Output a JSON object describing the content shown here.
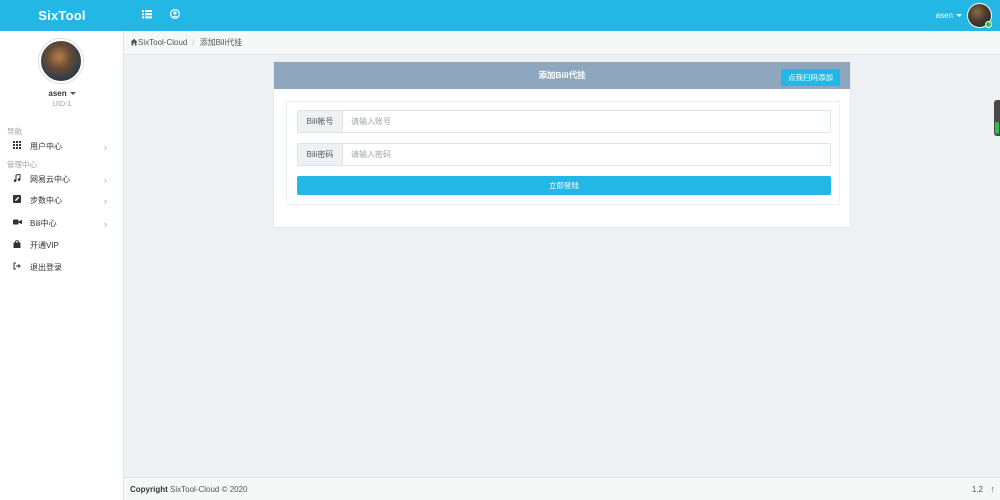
{
  "topbar": {
    "brand": "SixTool",
    "user_name": "asen"
  },
  "sidebar": {
    "user_name": "asen",
    "uid": "UID:1",
    "heading_nav": "导航",
    "heading_admin": "管理中心",
    "items": [
      {
        "label": "用户中心",
        "icon": "grid-icon",
        "chevron": "›"
      },
      {
        "label": "网易云中心",
        "icon": "music-note-icon",
        "chevron": "›"
      },
      {
        "label": "步数中心",
        "icon": "edit-square-icon",
        "chevron": "›"
      },
      {
        "label": "Bili中心",
        "icon": "video-camera-icon",
        "chevron": "›"
      },
      {
        "label": "开通VIP",
        "icon": "bag-icon"
      },
      {
        "label": "退出登录",
        "icon": "logout-icon"
      }
    ]
  },
  "breadcrumb": {
    "home": "SixTool-Cloud",
    "current": "添加Bili代挂"
  },
  "panel": {
    "title": "添加Bili代挂",
    "scan_button": "点我扫码添加",
    "account_label": "Bili帐号",
    "account_placeholder": "请输入账号",
    "password_label": "Bili密码",
    "password_placeholder": "请输入密码",
    "login_button": "立即登陆"
  },
  "footer": {
    "copyright_label": "Copyright",
    "copyright_text": "SixTool-Cloud © 2020",
    "version": "1.2",
    "up_arrow": "↑"
  },
  "colors": {
    "accent": "#23b7e5",
    "panel_header": "#8ea6be",
    "online": "#27c24c"
  }
}
